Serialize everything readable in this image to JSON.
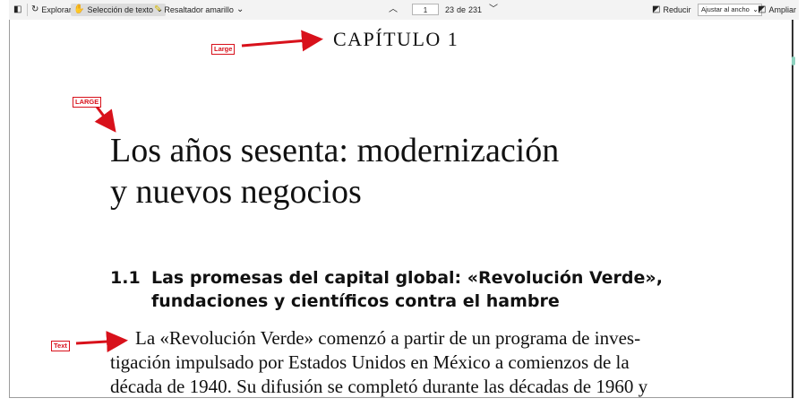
{
  "toolbar": {
    "sidebar_toggle_icon": "sidebar-toggle-icon",
    "explore_label": "Explorar",
    "text_select_label": "Selección de texto",
    "highlighter_label": "Resaltador amarillo",
    "current_page": "1",
    "page_display": "23",
    "page_of": "de",
    "page_total": "231",
    "zoom_out_label": "Reducir",
    "zoom_mode": "Ajustar al ancho",
    "zoom_in_label": "Ampliar"
  },
  "document": {
    "chapter": "CAPÍTULO 1",
    "title_line1": "Los años sesenta: modernización",
    "title_line2": "y nuevos negocios",
    "section_number": "1.1",
    "section_line1": "Las promesas del capital global: «Revolución Verde»,",
    "section_line2": "fundaciones y científicos contra el hambre",
    "body_line1": "La «Revolución Verde» comenzó a partir de un programa de inves-",
    "body_line2": "tigación impulsado por Estados Unidos en México a comienzos de la",
    "body_line3": "década de 1940. Su difusión se completó durante las décadas de 1960 y"
  },
  "annotations": {
    "chapter_label": "Large",
    "title_label": "LARGE",
    "body_label": "Text",
    "color": "#d8111b"
  }
}
